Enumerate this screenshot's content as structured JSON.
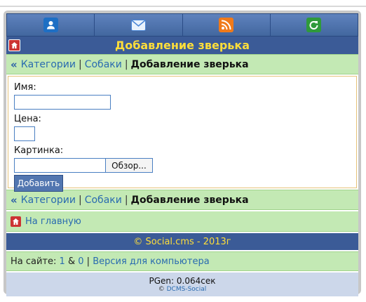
{
  "navbar": {
    "items": [
      {
        "icon": "user-icon",
        "color": "#1e6fc4"
      },
      {
        "icon": "mail-icon",
        "color": "#4a86d6"
      },
      {
        "icon": "rss-icon",
        "color": "#f07a1a"
      },
      {
        "icon": "refresh-icon",
        "color": "#2f9a3b"
      }
    ]
  },
  "title": "Добавление зверька",
  "breadcrumb": {
    "raquo": "«",
    "link1": "Категории",
    "sep1": "|",
    "link2": "Собаки",
    "sep2": "|",
    "current": "Добавление зверька"
  },
  "form": {
    "name_label": "Имя:",
    "price_label": "Цена:",
    "image_label": "Картинка:",
    "browse_label": "Обзор...",
    "submit_label": "Добавить",
    "name_value": "",
    "price_value": ""
  },
  "home_link": "На главную",
  "footer_copyright": "© Social.cms - 2013г",
  "online": {
    "prefix": "На сайте:",
    "count1": "1",
    "amp": "&",
    "count2": "0",
    "sep": "|",
    "desktop_link": "Версия для компьютера"
  },
  "pgen": {
    "text": "PGen: 0.064сек",
    "copyright_symbol": "©",
    "engine_link": "DCMS-Social"
  },
  "colors": {
    "accent": "#3b5b97",
    "title_text": "#ffde3a",
    "panel_green": "#c3e9b4"
  }
}
